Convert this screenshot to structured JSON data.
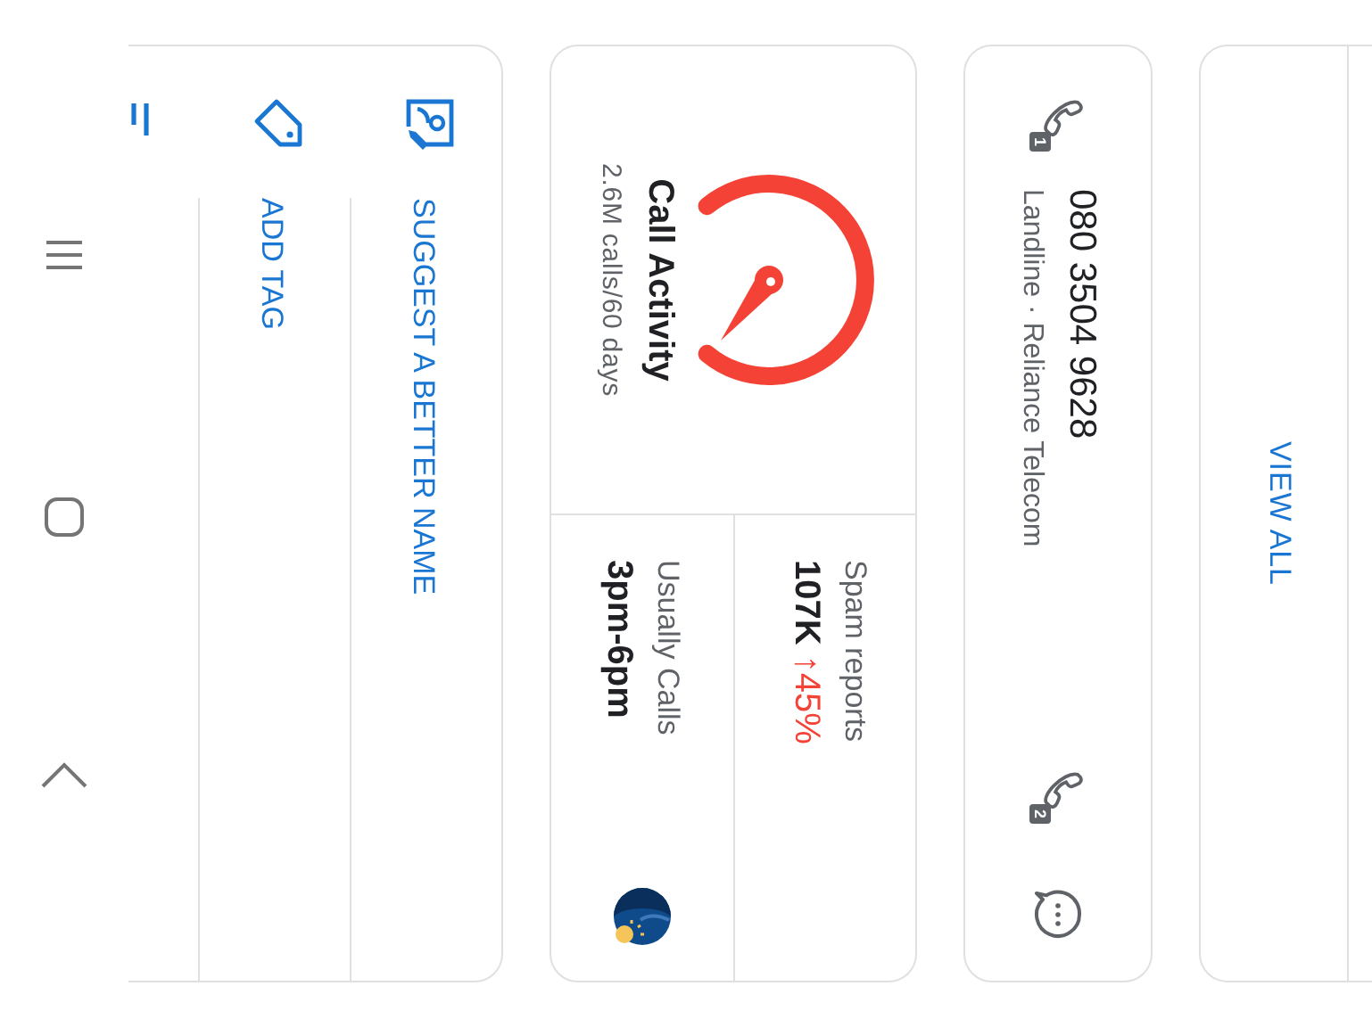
{
  "view_all": {
    "label": "VIEW ALL"
  },
  "number_card": {
    "number": "080 3504 9628",
    "details": "Landline · Reliance Telecom",
    "call_buttons": [
      {
        "sim": "1"
      },
      {
        "sim": "2"
      }
    ]
  },
  "stats": {
    "call_activity": {
      "title": "Call Activity",
      "subtitle": "2.6M calls/60 days"
    },
    "spam_reports": {
      "label": "Spam reports",
      "value": "107K",
      "change": "↑45%"
    },
    "usually_calls": {
      "label": "Usually Calls",
      "value": "3pm-6pm"
    }
  },
  "actions": [
    {
      "kind": "suggest",
      "label": "SUGGEST A BETTER NAME"
    },
    {
      "kind": "tag",
      "label": "ADD TAG"
    }
  ]
}
